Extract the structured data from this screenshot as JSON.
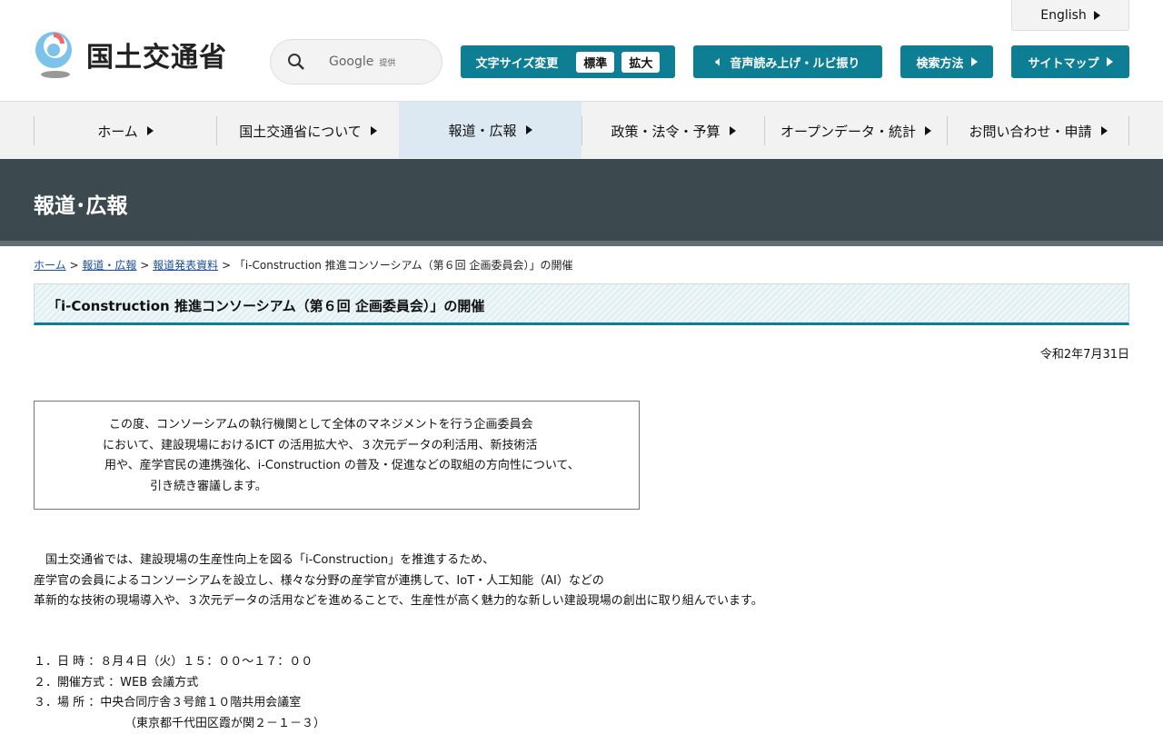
{
  "header": {
    "logo_text": "国土交通省",
    "english": "English",
    "search": {
      "brand": "Google",
      "provided": "提供"
    },
    "font_size": {
      "label": "文字サイズ変更",
      "standard": "標準",
      "large": "拡大"
    },
    "speech": "音声読み上げ・ルビ振り",
    "search_method": "検索方法",
    "sitemap": "サイトマップ"
  },
  "nav": [
    "ホーム",
    "国土交通省について",
    "報道・広報",
    "政策・法令・予算",
    "オープンデータ・統計",
    "お問い合わせ・申請"
  ],
  "banner": "報道･広報",
  "breadcrumb": {
    "items": [
      "ホーム",
      "報道・広報",
      "報道発表資料"
    ],
    "current": "「i-Construction 推進コンソーシアム（第６回 企画委員会）」の開催",
    "sep": ">"
  },
  "title": "「i-Construction 推進コンソーシアム（第６回 企画委員会）」の開催",
  "date": "令和2年7月31日",
  "summary": [
    "この度、コンソーシアムの執行機関として全体のマネジメントを行う企画委員会",
    "において、建設現場におけるICT の活用拡大や、３次元データの利活用、新技術活",
    "用や、産学官民の連携強化、i-Construction の普及・促進などの取組の方向性について、",
    "引き続き審議します。"
  ],
  "body": [
    "　国土交通省では、建設現場の生産性向上を図る「i-Construction」を推進するため、",
    "産学官の会員によるコンソーシアムを設立し、様々な分野の産学官が連携して、IoT・人工知能（AI）などの",
    "革新的な技術の現場導入や、３次元データの活用などを進めることで、生産性が高く魅力的な新しい建設現場の創出に取り組んでいます。"
  ],
  "details": [
    "１．日 時 ：８月４日（火）１５：００～１７：００",
    "２．開催方式 ：WEB 会議方式",
    "３．場 所 ：中央合同庁舎３号館１０階共用会議室",
    "（東京都千代田区霞が関２－１－３）"
  ]
}
